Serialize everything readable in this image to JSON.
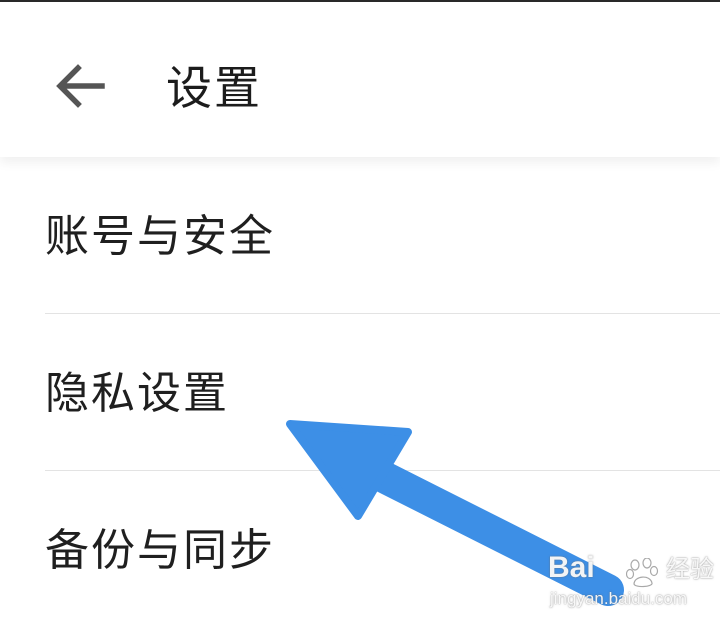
{
  "header": {
    "title": "设置",
    "back_icon": "arrow-left-icon"
  },
  "settings": {
    "items": [
      {
        "label": "账号与安全"
      },
      {
        "label": "隐私设置"
      },
      {
        "label": "备份与同步"
      }
    ]
  },
  "annotation": {
    "color": "#3d8fe6"
  },
  "watermark": {
    "brand": "Bai",
    "brand_suffix": "",
    "product": "经验",
    "url": "jingyan.baidu.com"
  },
  "colors": {
    "background": "#ffffff",
    "text": "#1f1f1f",
    "divider": "#e3e3e3",
    "icon": "#555555"
  }
}
